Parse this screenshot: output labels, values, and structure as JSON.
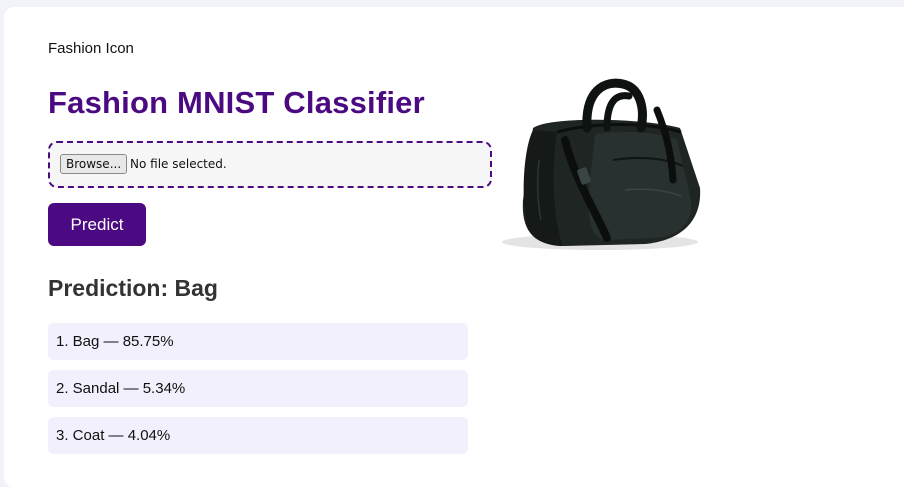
{
  "header": {
    "logo_alt_text": "Fashion Icon",
    "title": "Fashion MNIST Classifier"
  },
  "upload": {
    "browse_label": "Browse...",
    "file_status": "No file selected."
  },
  "predict_button_label": "Predict",
  "prediction": {
    "heading": "Prediction: Bag",
    "results": [
      {
        "text": "1. Bag — 85.75%"
      },
      {
        "text": "2. Sandal — 5.34%"
      },
      {
        "text": "3. Coat — 4.04%"
      }
    ]
  },
  "colors": {
    "accent": "#4b0a82",
    "result_bg": "#f1f0fc",
    "page_bg": "#f2f3f9"
  },
  "image": {
    "icon": "duffel-bag-photo"
  }
}
